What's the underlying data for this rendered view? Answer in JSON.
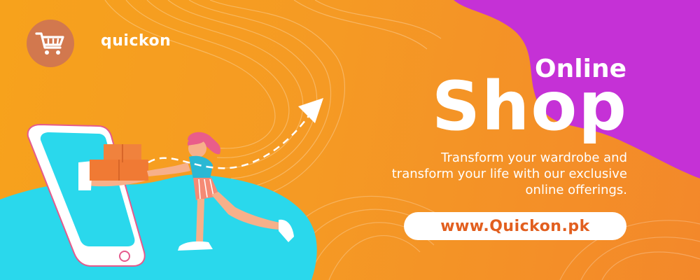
{
  "brand": {
    "name": "quickon",
    "logo_icon": "shopping-cart-icon"
  },
  "headline": {
    "line1": "Online",
    "line2": "Shop"
  },
  "tagline": {
    "lines": [
      "Transform your wardrobe and",
      "transform your life with our exclusive",
      "online offerings."
    ]
  },
  "cta": {
    "url_label": "www.Quickon.pk"
  },
  "colors": {
    "background": "#f7a21c",
    "accent_purple": "#c531d6",
    "accent_cyan": "#2ad8ec",
    "cta_text": "#e25f1f",
    "logo_circle": "#d2784e"
  }
}
